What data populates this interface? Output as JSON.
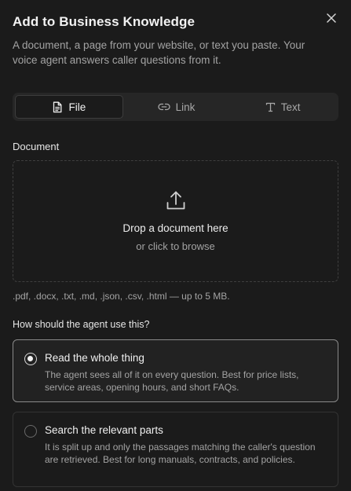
{
  "dialog": {
    "title": "Add to Business Knowledge",
    "subtitle": "A document, a page from your website, or text you paste. Your voice agent answers caller questions from it.",
    "close_icon": "close-icon"
  },
  "tabs": [
    {
      "label": "File",
      "icon": "file-icon",
      "active": true
    },
    {
      "label": "Link",
      "icon": "link-icon",
      "active": false
    },
    {
      "label": "Text",
      "icon": "text-icon",
      "active": false
    }
  ],
  "document": {
    "label": "Document",
    "drop_main": "Drop a document here",
    "drop_sub": "or click to browse",
    "hint": ".pdf, .docx, .txt, .md, .json, .csv, .html — up to 5 MB."
  },
  "usage": {
    "question": "How should the agent use this?",
    "options": [
      {
        "title": "Read the whole thing",
        "description": "The agent sees all of it on every question. Best for price lists, service areas, opening hours, and short FAQs.",
        "selected": true
      },
      {
        "title": "Search the relevant parts",
        "description": "It is split up and only the passages matching the caller's question are retrieved. Best for long manuals, contracts, and policies.",
        "selected": false
      }
    ]
  },
  "colors": {
    "background": "#1b1b1b",
    "text_primary": "#f2f2f2",
    "text_muted": "#a3a3a3",
    "border": "#333333",
    "selected_border": "#8a8a8a"
  }
}
